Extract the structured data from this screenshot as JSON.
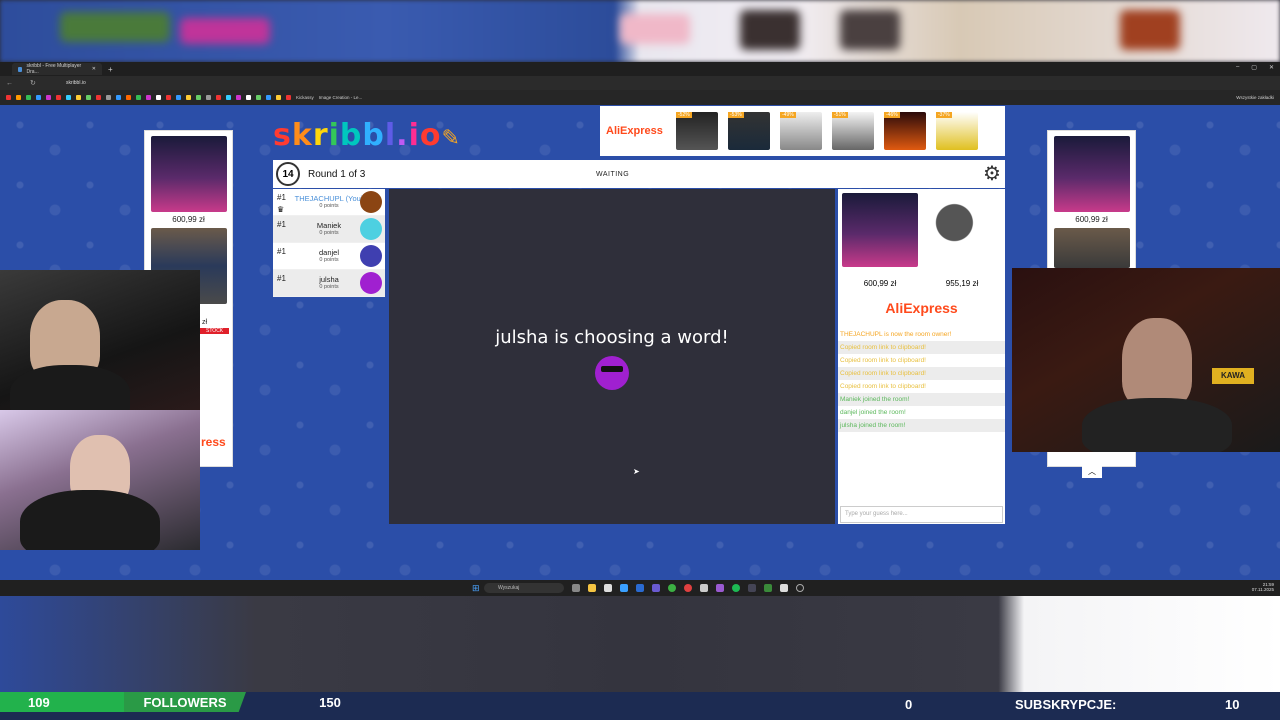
{
  "browser": {
    "tab_title": "skribbl - Free Multiplayer Dra...",
    "url": "skribbl.io",
    "bookmarks_labels": [
      "Kickassy",
      "Image Creation - Le..."
    ],
    "bookmarks_right": "Wszystkie zakładki"
  },
  "logo": {
    "letters": [
      "s",
      "k",
      "r",
      "i",
      "b",
      "b",
      "l",
      ".",
      "i",
      "o"
    ],
    "colors": [
      "#ff3b30",
      "#ff8c1a",
      "#ffd60a",
      "#34c759",
      "#00c7be",
      "#30b0ff",
      "#5e5ce6",
      "#bf5af2",
      "#ff2d92",
      "#ff3b30"
    ]
  },
  "banner": {
    "brand": "AliExpress",
    "badges": [
      "-52%",
      "-53%",
      "-49%",
      "-51%",
      "-46%",
      "-37%"
    ]
  },
  "game": {
    "timer": "14",
    "round_label": "Round 1 of 3",
    "status": "WAITING",
    "canvas_message": "julsha is choosing a word!"
  },
  "players": [
    {
      "rank": "#1",
      "name": "THEJACHUPL (You)",
      "points": "0 points",
      "avatar_color": "#8b4513",
      "self": true,
      "owner": true
    },
    {
      "rank": "#1",
      "name": "Maniek",
      "points": "0 points",
      "avatar_color": "#4dd0e1",
      "self": false,
      "owner": false
    },
    {
      "rank": "#1",
      "name": "danjel",
      "points": "0 points",
      "avatar_color": "#3f3fb0",
      "self": false,
      "owner": false
    },
    {
      "rank": "#1",
      "name": "julsha",
      "points": "0 points",
      "avatar_color": "#a020d0",
      "self": false,
      "owner": false
    }
  ],
  "side_ads": {
    "left_price": "600,99 zł",
    "left_price_2": "zł",
    "left_brand_fragment": "ress",
    "left_stock": "STOCK",
    "right_price": "600,99 zł"
  },
  "chat": {
    "ad_prices": [
      "600,99 zł",
      "955,19 zł"
    ],
    "brand": "AliExpress",
    "messages": [
      {
        "text": "THEJACHUPL is now the room owner!",
        "kind": "owner"
      },
      {
        "text": "Copied room link to clipboard!",
        "kind": "copy"
      },
      {
        "text": "Copied room link to clipboard!",
        "kind": "copy"
      },
      {
        "text": "Copied room link to clipboard!",
        "kind": "copy"
      },
      {
        "text": "Copied room link to clipboard!",
        "kind": "copy"
      },
      {
        "text": "Maniek joined the room!",
        "kind": "join"
      },
      {
        "text": "danjel joined the room!",
        "kind": "join"
      },
      {
        "text": "julsha joined the room!",
        "kind": "join"
      }
    ],
    "input_placeholder": "Type your guess here..."
  },
  "taskbar": {
    "search": "Wyszukaj",
    "time": "21:59",
    "date": "07.11.2025"
  },
  "stream_bar": {
    "followers_current": "109",
    "followers_label": "FOLLOWERS",
    "followers_goal": "150",
    "subs_current": "0",
    "subs_label": "SUBSKRYPCJE:",
    "subs_goal": "10"
  }
}
